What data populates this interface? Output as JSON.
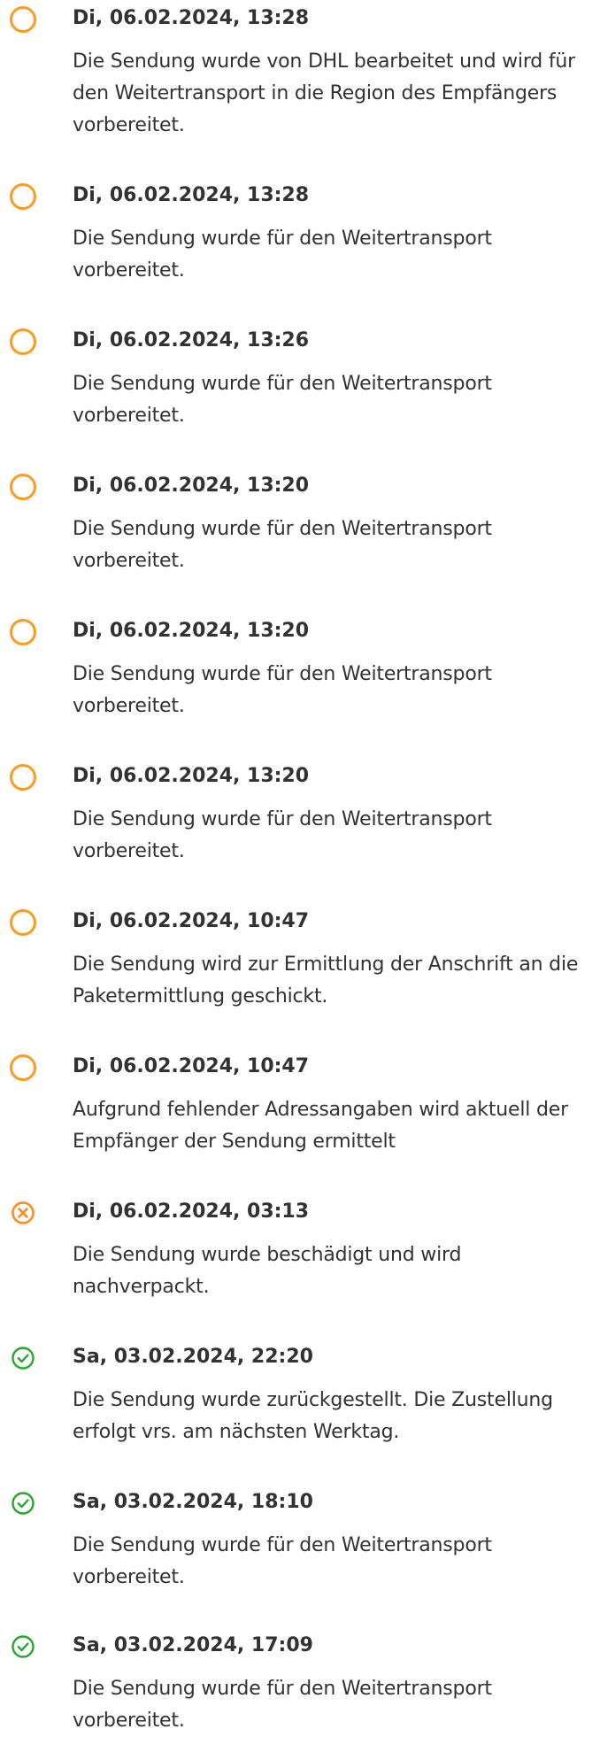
{
  "colors": {
    "pending": "#ff9a1f",
    "error": "#ff8a1a",
    "done": "#2aa52e",
    "text": "#323232"
  },
  "events": [
    {
      "date": "Di, 06.02.2024, 13:28",
      "text": "Die Sendung wurde von DHL bearbeitet und wird für den Weitertransport in die Region des Empfängers vorbereitet.",
      "status": "pending",
      "icon": "circle-icon"
    },
    {
      "date": "Di, 06.02.2024, 13:28",
      "text": "Die Sendung wurde für den Weitertransport vorbereitet.",
      "status": "pending",
      "icon": "circle-icon"
    },
    {
      "date": "Di, 06.02.2024, 13:26",
      "text": "Die Sendung wurde für den Weitertransport vorbereitet.",
      "status": "pending",
      "icon": "circle-icon"
    },
    {
      "date": "Di, 06.02.2024, 13:20",
      "text": "Die Sendung wurde für den Weitertransport vorbereitet.",
      "status": "pending",
      "icon": "circle-icon"
    },
    {
      "date": "Di, 06.02.2024, 13:20",
      "text": "Die Sendung wurde für den Weitertransport vorbereitet.",
      "status": "pending",
      "icon": "circle-icon"
    },
    {
      "date": "Di, 06.02.2024, 13:20",
      "text": "Die Sendung wurde für den Weitertransport vorbereitet.",
      "status": "pending",
      "icon": "circle-icon"
    },
    {
      "date": "Di, 06.02.2024, 10:47",
      "text": "Die Sendung wird zur Ermittlung der Anschrift an die Paketermittlung geschickt.",
      "status": "pending",
      "icon": "circle-icon"
    },
    {
      "date": "Di, 06.02.2024, 10:47",
      "text": "Aufgrund fehlender Adressangaben wird aktuell der Empfänger der Sendung ermittelt",
      "status": "pending",
      "icon": "circle-icon"
    },
    {
      "date": "Di, 06.02.2024, 03:13",
      "text": "Die Sendung wurde beschädigt und wird nachverpackt.",
      "status": "error",
      "icon": "x-circle-icon"
    },
    {
      "date": "Sa, 03.02.2024, 22:20",
      "text": "Die Sendung wurde zurückgestellt. Die Zustellung erfolgt vrs. am nächsten Werktag.",
      "status": "done",
      "icon": "check-circle-icon"
    },
    {
      "date": "Sa, 03.02.2024, 18:10",
      "text": "Die Sendung wurde für den Weitertransport vorbereitet.",
      "status": "done",
      "icon": "check-circle-icon"
    },
    {
      "date": "Sa, 03.02.2024, 17:09",
      "text": "Die Sendung wurde für den Weitertransport vorbereitet.",
      "status": "done",
      "icon": "check-circle-icon"
    }
  ]
}
